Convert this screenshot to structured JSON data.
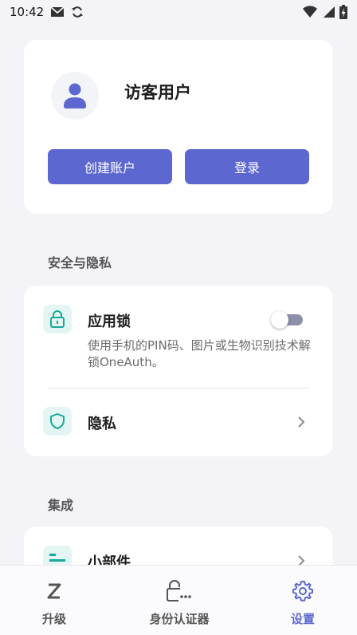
{
  "status_bar": {
    "time": "10:42",
    "icons": [
      "mail-icon",
      "sync-icon",
      "wifi-icon",
      "signal-icon",
      "battery-icon"
    ]
  },
  "profile": {
    "name": "访客用户",
    "avatar_icon": "user-icon",
    "create_account_label": "创建账户",
    "login_label": "登录"
  },
  "security": {
    "section_title": "安全与隐私",
    "app_lock": {
      "title": "应用锁",
      "description": "使用手机的PIN码、图片或生物识别技术解锁OneAuth。",
      "icon": "lock-icon",
      "enabled": false
    },
    "privacy": {
      "title": "隐私",
      "icon": "shield-icon"
    }
  },
  "integration": {
    "section_title": "集成",
    "widget": {
      "title": "小部件",
      "icon": "widget-icon"
    }
  },
  "bottom_nav": {
    "upgrade": "升级",
    "authenticator": "身份认证器",
    "settings": "设置",
    "active": "settings"
  },
  "colors": {
    "accent": "#5c67cf",
    "icon_bg": "#e4f6f3",
    "icon_teal": "#17a99a",
    "background": "#f4f4f8"
  }
}
